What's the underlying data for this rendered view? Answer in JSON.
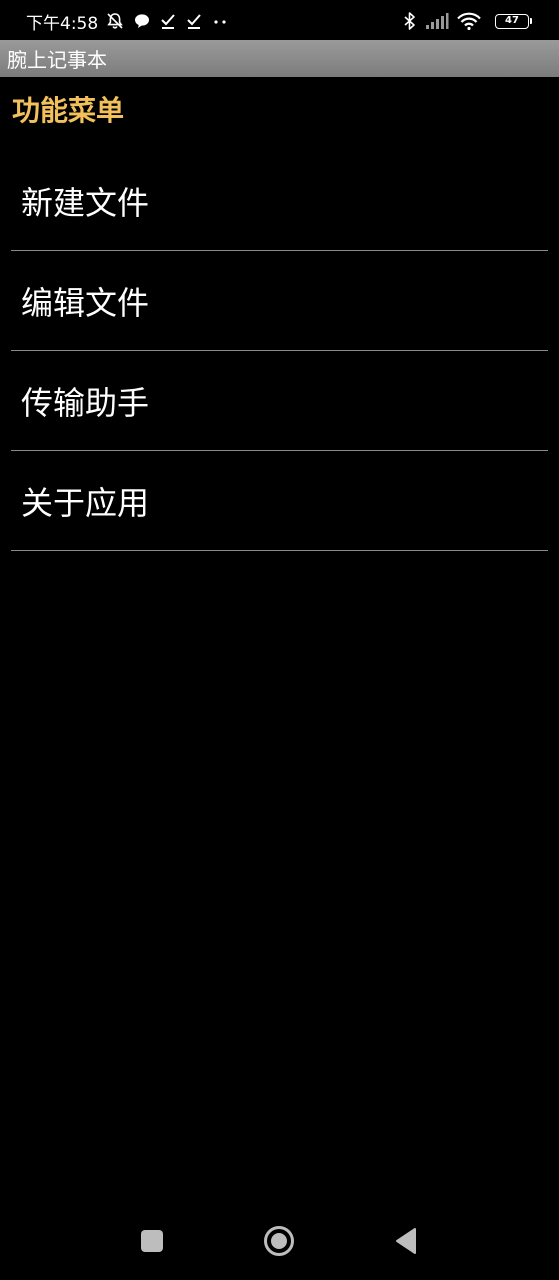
{
  "status_bar": {
    "time": "下午4:58",
    "battery_level": "47",
    "icons_left": [
      "mute-bell-icon",
      "chat-bubble-icon",
      "check-icon",
      "check-icon",
      "more-dots-icon"
    ],
    "icons_right": [
      "bluetooth-icon",
      "cellular-signal-icon",
      "wifi-icon",
      "battery-icon"
    ]
  },
  "app": {
    "title": "腕上记事本"
  },
  "menu": {
    "header": "功能菜单",
    "header_color": "#f2c15c",
    "items": [
      {
        "label": "新建文件"
      },
      {
        "label": "编辑文件"
      },
      {
        "label": "传输助手"
      },
      {
        "label": "关于应用"
      }
    ]
  },
  "nav_bar": {
    "buttons": [
      "recents-square-icon",
      "home-circle-icon",
      "back-triangle-icon"
    ]
  }
}
